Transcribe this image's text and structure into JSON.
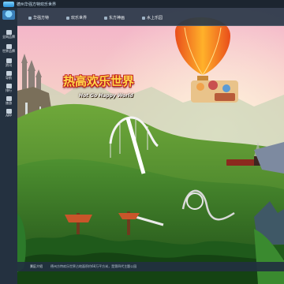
{
  "topbar": {
    "brand_text": "德州华强方特欢乐世界"
  },
  "sidebar": {
    "items": [
      {
        "label": "全网品牌",
        "icon": "badge-icon"
      },
      {
        "label": "世界品牌",
        "icon": "globe-icon"
      },
      {
        "label": "资讯",
        "icon": "news-icon"
      },
      {
        "label": "导航",
        "icon": "map-icon"
      },
      {
        "label": "排行",
        "icon": "rank-icon"
      },
      {
        "label": "旅游",
        "icon": "travel-icon"
      },
      {
        "label": "APP",
        "icon": "app-icon"
      }
    ]
  },
  "navbar": {
    "tabs": [
      {
        "label": "华强方特"
      },
      {
        "label": "欢乐世界"
      },
      {
        "label": "东方神画"
      },
      {
        "label": "水上乐园"
      }
    ]
  },
  "hero": {
    "title_cn": "热高欢乐世界",
    "title_en": "Hot Go Happy World"
  },
  "footer": {
    "label": "景区介绍",
    "text": "德州方特欢乐世界占地面积约68万平方米，是第四代主题公园"
  },
  "colors": {
    "nav_bg": "#283748",
    "sidebar_bg": "#243140",
    "title_yellow": "#ffd84a",
    "title_red": "#c21d1d"
  }
}
